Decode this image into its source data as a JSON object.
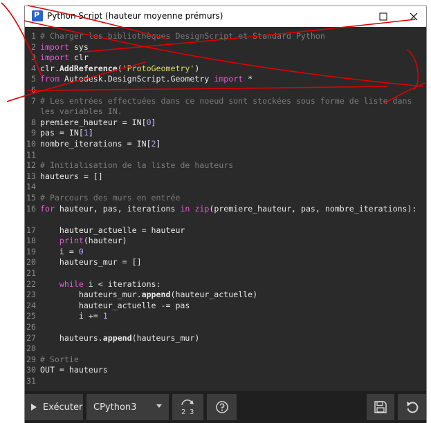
{
  "window": {
    "title": "Python Script (hauteur moyenne prémurs)",
    "icon": "dynamo-python-icon"
  },
  "editor": {
    "lines": [
      {
        "n": "1",
        "segs": [
          [
            "comment",
            "# Charger les bibliothèques DesignScript et Standard Python"
          ]
        ]
      },
      {
        "n": "2",
        "segs": [
          [
            "kw",
            "import"
          ],
          [
            "plain",
            " sys"
          ]
        ]
      },
      {
        "n": "3",
        "segs": [
          [
            "kw",
            "import"
          ],
          [
            "plain",
            " clr"
          ]
        ]
      },
      {
        "n": "4",
        "segs": [
          [
            "plain",
            "clr."
          ],
          [
            "bold",
            "AddReference"
          ],
          [
            "plain",
            "("
          ],
          [
            "str",
            "'ProtoGeometry'"
          ],
          [
            "plain",
            ")"
          ]
        ]
      },
      {
        "n": "5",
        "segs": [
          [
            "kw",
            "from"
          ],
          [
            "plain",
            " Autodesk.DesignScript.Geometry "
          ],
          [
            "kw",
            "import"
          ],
          [
            "plain",
            " *"
          ]
        ]
      },
      {
        "n": "6",
        "segs": []
      },
      {
        "n": "7",
        "wrap": true,
        "segs": [
          [
            "comment",
            "# Les entrées effectuées dans ce noeud sont stockées sous forme de liste dans les variables IN."
          ]
        ]
      },
      {
        "n": "8",
        "segs": [
          [
            "plain",
            "premiere_hauteur = IN["
          ],
          [
            "num",
            "0"
          ],
          [
            "plain",
            "]"
          ]
        ]
      },
      {
        "n": "9",
        "segs": [
          [
            "plain",
            "pas = IN["
          ],
          [
            "num",
            "1"
          ],
          [
            "plain",
            "]"
          ]
        ]
      },
      {
        "n": "10",
        "segs": [
          [
            "plain",
            "nombre_iterations = IN["
          ],
          [
            "num",
            "2"
          ],
          [
            "plain",
            "]"
          ]
        ]
      },
      {
        "n": "11",
        "segs": []
      },
      {
        "n": "12",
        "segs": [
          [
            "comment",
            "# Initialisation de la liste de hauteurs"
          ]
        ]
      },
      {
        "n": "13",
        "segs": [
          [
            "plain",
            "hauteurs = []"
          ]
        ]
      },
      {
        "n": "14",
        "segs": []
      },
      {
        "n": "15",
        "segs": [
          [
            "comment",
            "# Parcours des murs en entrée"
          ]
        ]
      },
      {
        "n": "16",
        "wrap": true,
        "segs": [
          [
            "kw",
            "for"
          ],
          [
            "plain",
            " hauteur, pas, iterations "
          ],
          [
            "kw",
            "in"
          ],
          [
            "plain",
            " "
          ],
          [
            "fn",
            "zip"
          ],
          [
            "plain",
            "(premiere_hauteur, pas, nombre_iterations):"
          ]
        ]
      },
      {
        "n": "17",
        "segs": [
          [
            "plain",
            "    hauteur_actuelle = hauteur"
          ]
        ]
      },
      {
        "n": "18",
        "segs": [
          [
            "plain",
            "    "
          ],
          [
            "fn",
            "print"
          ],
          [
            "plain",
            "(hauteur)"
          ]
        ]
      },
      {
        "n": "19",
        "segs": [
          [
            "plain",
            "    i = "
          ],
          [
            "num",
            "0"
          ]
        ]
      },
      {
        "n": "20",
        "segs": [
          [
            "plain",
            "    hauteurs_mur = []"
          ]
        ]
      },
      {
        "n": "21",
        "segs": []
      },
      {
        "n": "22",
        "segs": [
          [
            "plain",
            "    "
          ],
          [
            "kw",
            "while"
          ],
          [
            "plain",
            " i < iterations:"
          ]
        ]
      },
      {
        "n": "23",
        "segs": [
          [
            "plain",
            "        hauteurs_mur."
          ],
          [
            "bold",
            "append"
          ],
          [
            "plain",
            "(hauteur_actuelle)"
          ]
        ]
      },
      {
        "n": "24",
        "segs": [
          [
            "plain",
            "        hauteur_actuelle -= pas"
          ]
        ]
      },
      {
        "n": "25",
        "segs": [
          [
            "plain",
            "        i += "
          ],
          [
            "num",
            "1"
          ]
        ]
      },
      {
        "n": "26",
        "segs": []
      },
      {
        "n": "27",
        "segs": [
          [
            "plain",
            "    hauteurs."
          ],
          [
            "bold",
            "append"
          ],
          [
            "plain",
            "(hauteurs_mur)"
          ]
        ]
      },
      {
        "n": "28",
        "segs": []
      },
      {
        "n": "29",
        "segs": [
          [
            "comment",
            "# Sortie"
          ]
        ]
      },
      {
        "n": "30",
        "segs": [
          [
            "plain",
            "OUT = hauteurs"
          ]
        ]
      },
      {
        "n": "31",
        "segs": []
      }
    ]
  },
  "footer": {
    "run_label": "Exécuter",
    "engine_value": "CPython3",
    "migrate_label_top": "2",
    "migrate_label_bottom": "3"
  },
  "colors": {
    "editor_bg": "#2a2a2a",
    "keyword": "#e35bd6",
    "string": "#dedc6e",
    "number": "#b5a2ff",
    "comment": "#7b7b7b",
    "annotation": "#e00000"
  }
}
